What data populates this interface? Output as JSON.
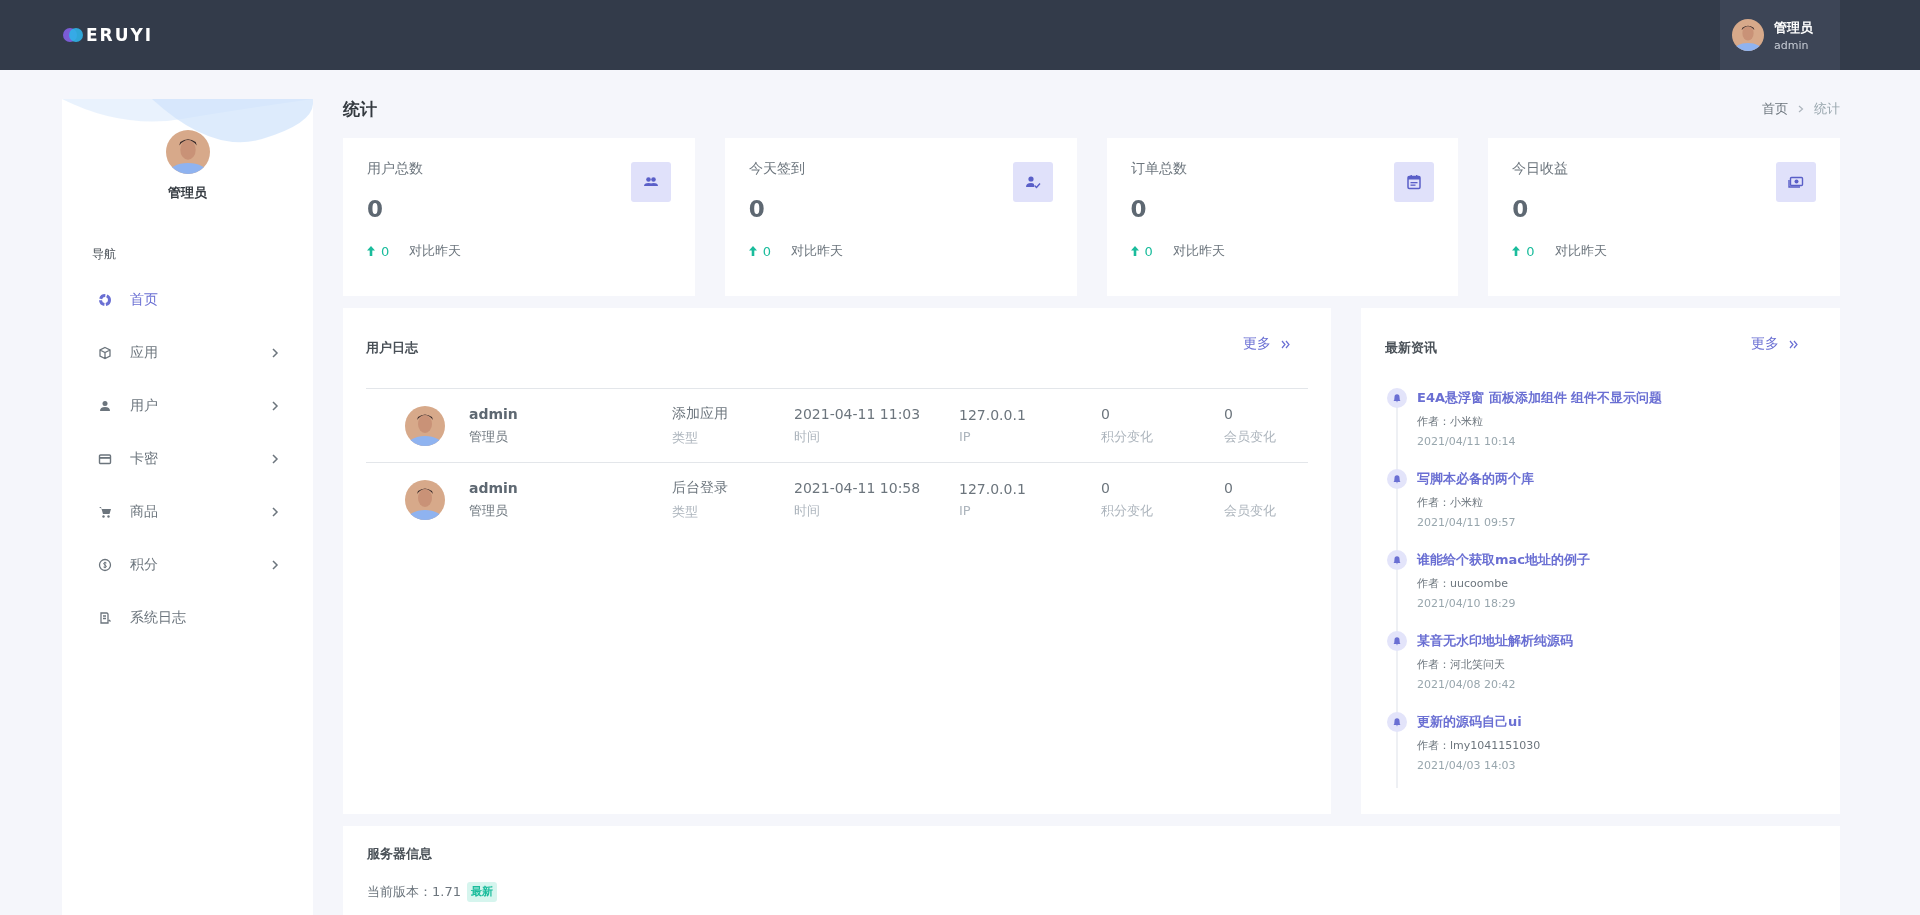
{
  "header": {
    "logo": "ERUYI",
    "user": {
      "name": "管理员",
      "role": "admin"
    }
  },
  "sidebar": {
    "profile_name": "管理员",
    "section_label": "导航",
    "items": [
      {
        "label": "首页",
        "kind": "donut",
        "selected": true,
        "expandable": false
      },
      {
        "label": "应用",
        "kind": "cube",
        "selected": false,
        "expandable": true
      },
      {
        "label": "用户",
        "kind": "person",
        "selected": false,
        "expandable": true
      },
      {
        "label": "卡密",
        "kind": "card",
        "selected": false,
        "expandable": true
      },
      {
        "label": "商品",
        "kind": "cart",
        "selected": false,
        "expandable": true
      },
      {
        "label": "积分",
        "kind": "coin",
        "selected": false,
        "expandable": true
      },
      {
        "label": "系统日志",
        "kind": "log",
        "selected": false,
        "expandable": false
      }
    ]
  },
  "page_title": "统计",
  "breadcrumb": [
    "首页",
    "统计"
  ],
  "stats": [
    {
      "title": "用户总数",
      "value": "0",
      "change": "0",
      "compare": "对比昨天",
      "kind": "users"
    },
    {
      "title": "今天签到",
      "value": "0",
      "change": "0",
      "compare": "对比昨天",
      "kind": "checkin"
    },
    {
      "title": "订单总数",
      "value": "0",
      "change": "0",
      "compare": "对比昨天",
      "kind": "calendar"
    },
    {
      "title": "今日收益",
      "value": "0",
      "change": "0",
      "compare": "对比昨天",
      "kind": "cash"
    }
  ],
  "user_log": {
    "title": "用户日志",
    "more": "更多",
    "rows": [
      {
        "name": "admin",
        "role": "管理员",
        "type": "添加应用",
        "type_label": "类型",
        "time": "2021-04-11 11:03",
        "time_label": "时间",
        "ip": "127.0.0.1",
        "ip_label": "IP",
        "points": "0",
        "points_label": "积分变化",
        "member": "0",
        "member_label": "会员变化"
      },
      {
        "name": "admin",
        "role": "管理员",
        "type": "后台登录",
        "type_label": "类型",
        "time": "2021-04-11 10:58",
        "time_label": "时间",
        "ip": "127.0.0.1",
        "ip_label": "IP",
        "points": "0",
        "points_label": "积分变化",
        "member": "0",
        "member_label": "会员变化"
      }
    ]
  },
  "news": {
    "title": "最新资讯",
    "more": "更多",
    "items": [
      {
        "title": "E4A悬浮窗 面板添加组件 组件不显示问题",
        "author": "作者：小米粒",
        "date": "2021/04/11 10:14"
      },
      {
        "title": "写脚本必备的两个库",
        "author": "作者：小米粒",
        "date": "2021/04/11 09:57"
      },
      {
        "title": "谁能给个获取mac地址的例子",
        "author": "作者：uucoombe",
        "date": "2021/04/10 18:29"
      },
      {
        "title": "某音无水印地址解析纯源码",
        "author": "作者：河北笑问天",
        "date": "2021/04/08 20:42"
      },
      {
        "title": "更新的源码自己ui",
        "author": "作者：lmy1041151030",
        "date": "2021/04/03 14:03"
      }
    ]
  },
  "server_info": {
    "title": "服务器信息",
    "version_label": "当前版本：1.71",
    "badge": "最新"
  }
}
